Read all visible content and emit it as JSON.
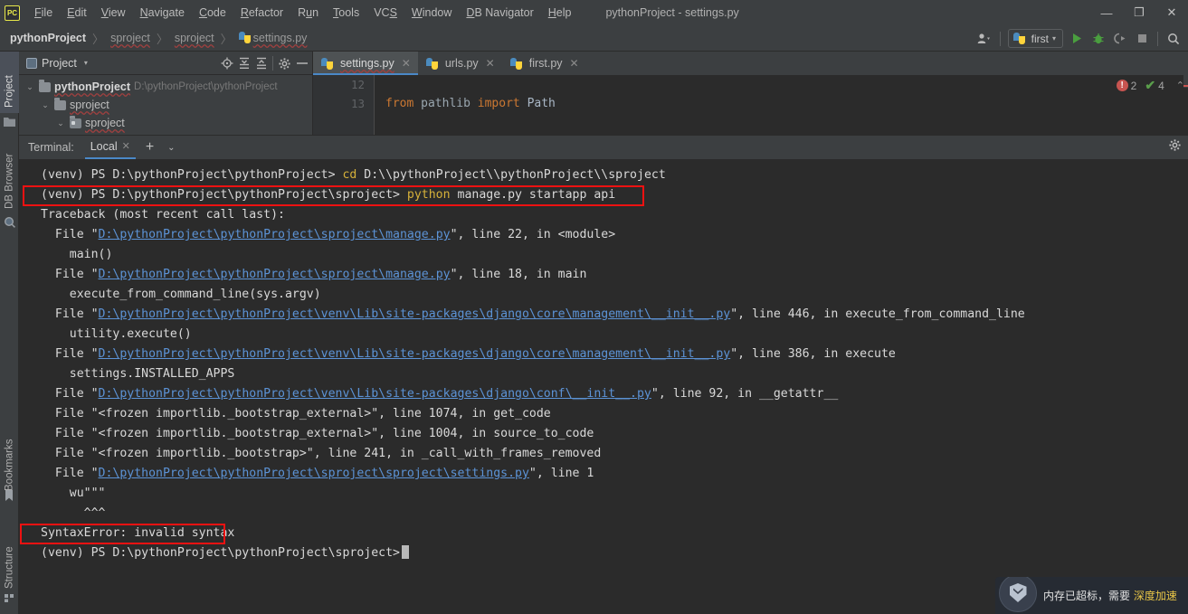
{
  "titlebar": {
    "logo": "PC",
    "window_title": "pythonProject - settings.py",
    "menus": [
      {
        "label": "File",
        "mnemonic": "F"
      },
      {
        "label": "Edit",
        "mnemonic": "E"
      },
      {
        "label": "View",
        "mnemonic": "V"
      },
      {
        "label": "Navigate",
        "mnemonic": "N"
      },
      {
        "label": "Code",
        "mnemonic": "C"
      },
      {
        "label": "Refactor",
        "mnemonic": "R"
      },
      {
        "label": "Run",
        "mnemonic": "u"
      },
      {
        "label": "Tools",
        "mnemonic": "T"
      },
      {
        "label": "VCS",
        "mnemonic": "S"
      },
      {
        "label": "Window",
        "mnemonic": "W"
      },
      {
        "label": "DB Navigator",
        "mnemonic": "D"
      },
      {
        "label": "Help",
        "mnemonic": "H"
      }
    ],
    "controls": {
      "minimize": "—",
      "maximize": "❐",
      "close": "✕"
    }
  },
  "breadcrumb": {
    "items": [
      "pythonProject",
      "sproject",
      "sproject",
      "settings.py"
    ],
    "separator": "〉",
    "file_icon": "python-file-icon"
  },
  "toolbar": {
    "user_icon": "user-icon",
    "run_config": {
      "name": "first",
      "icon": "python-icon",
      "caret": "▾"
    },
    "run_icon": "▶",
    "debug_icon": "debug-bug-icon",
    "coverage_icon": "coverage-run-icon",
    "stop_icon": "■",
    "search_icon": "search-icon"
  },
  "left_strip": [
    {
      "label": "Project",
      "active": true,
      "icon": "folder-icon"
    },
    {
      "label": "DB Browser",
      "active": false,
      "icon": "db-icon"
    },
    {
      "label": "Bookmarks",
      "active": false,
      "icon": "bookmark-icon"
    },
    {
      "label": "Structure",
      "active": false,
      "icon": "structure-icon"
    }
  ],
  "project_panel": {
    "title": "Project",
    "dropdown_caret": "▾",
    "tools": [
      "locate-icon",
      "expand-all-icon",
      "collapse-all-icon",
      "settings-gear-icon",
      "hide-panel-icon"
    ],
    "tree": [
      {
        "label": "pythonProject",
        "path": "D:\\pythonProject\\pythonProject",
        "depth": 0,
        "expanded": true,
        "bold": true,
        "kind": "folder"
      },
      {
        "label": "sproject",
        "path": "",
        "depth": 1,
        "expanded": true,
        "bold": false,
        "kind": "folder"
      },
      {
        "label": "sproject",
        "path": "",
        "depth": 2,
        "expanded": true,
        "bold": false,
        "kind": "module"
      }
    ]
  },
  "editor": {
    "tabs": [
      {
        "label": "settings.py",
        "active": true
      },
      {
        "label": "urls.py",
        "active": false
      },
      {
        "label": "first.py",
        "active": false
      }
    ],
    "close_glyph": "✕",
    "lines": [
      {
        "num": "12",
        "tokens": []
      },
      {
        "num": "13",
        "tokens": [
          {
            "text": "from ",
            "cls": "kw"
          },
          {
            "text": "pathlib ",
            "cls": "mod-name"
          },
          {
            "text": "import ",
            "cls": "kw"
          },
          {
            "text": "Path",
            "cls": "ident"
          }
        ]
      }
    ],
    "status": {
      "error_glyph": "!",
      "error_count": "2",
      "check_glyph": "✔",
      "check_count": "4",
      "chevron": "⌃"
    }
  },
  "terminal": {
    "label": "Terminal:",
    "tab": "Local",
    "close_glyph": "✕",
    "plus": "+",
    "chevron": "⌄",
    "gear": "settings-gear-icon",
    "lines": [
      {
        "id": "l1",
        "segments": [
          {
            "text": "(venv) PS D:\\pythonProject\\pythonProject> ",
            "cls": "c-white"
          },
          {
            "text": "cd ",
            "cls": "c-yellow"
          },
          {
            "text": "D:\\\\pythonProject\\\\pythonProject\\\\sproject",
            "cls": "c-white"
          }
        ]
      },
      {
        "id": "l2",
        "highlighted": true,
        "segments": [
          {
            "text": "(venv) PS D:\\pythonProject\\pythonProject\\sproject> ",
            "cls": "c-white"
          },
          {
            "text": "python ",
            "cls": "c-yellow"
          },
          {
            "text": "manage.py startapp api",
            "cls": "c-white"
          }
        ]
      },
      {
        "id": "l3",
        "segments": [
          {
            "text": "Traceback (most recent call last):",
            "cls": "c-white"
          }
        ]
      },
      {
        "id": "l4",
        "segments": [
          {
            "text": "  File \"",
            "cls": "c-white"
          },
          {
            "text": "D:\\pythonProject\\pythonProject\\sproject\\manage.py",
            "cls": "c-link"
          },
          {
            "text": "\", line 22, in <module>",
            "cls": "c-white"
          }
        ]
      },
      {
        "id": "l5",
        "segments": [
          {
            "text": "    main()",
            "cls": "c-white"
          }
        ]
      },
      {
        "id": "l6",
        "segments": [
          {
            "text": "  File \"",
            "cls": "c-white"
          },
          {
            "text": "D:\\pythonProject\\pythonProject\\sproject\\manage.py",
            "cls": "c-link"
          },
          {
            "text": "\", line 18, in main",
            "cls": "c-white"
          }
        ]
      },
      {
        "id": "l7",
        "segments": [
          {
            "text": "    execute_from_command_line(sys.argv)",
            "cls": "c-white"
          }
        ]
      },
      {
        "id": "l8",
        "segments": [
          {
            "text": "  File \"",
            "cls": "c-white"
          },
          {
            "text": "D:\\pythonProject\\pythonProject\\venv\\Lib\\site-packages\\django\\core\\management\\__init__.py",
            "cls": "c-link"
          },
          {
            "text": "\", line 446, in execute_from_command_line",
            "cls": "c-white"
          }
        ]
      },
      {
        "id": "l9",
        "segments": [
          {
            "text": "    utility.execute()",
            "cls": "c-white"
          }
        ]
      },
      {
        "id": "l10",
        "segments": [
          {
            "text": "  File \"",
            "cls": "c-white"
          },
          {
            "text": "D:\\pythonProject\\pythonProject\\venv\\Lib\\site-packages\\django\\core\\management\\__init__.py",
            "cls": "c-link"
          },
          {
            "text": "\", line 386, in execute",
            "cls": "c-white"
          }
        ]
      },
      {
        "id": "l11",
        "segments": [
          {
            "text": "    settings.INSTALLED_APPS",
            "cls": "c-white"
          }
        ]
      },
      {
        "id": "l12",
        "segments": [
          {
            "text": "  File \"",
            "cls": "c-white"
          },
          {
            "text": "D:\\pythonProject\\pythonProject\\venv\\Lib\\site-packages\\django\\conf\\__init__.py",
            "cls": "c-link"
          },
          {
            "text": "\", line 92, in __getattr__",
            "cls": "c-white"
          }
        ]
      },
      {
        "id": "l13",
        "segments": [
          {
            "text": "  File \"<frozen importlib._bootstrap_external>\", line 1074, in get_code",
            "cls": "c-white"
          }
        ]
      },
      {
        "id": "l14",
        "segments": [
          {
            "text": "  File \"<frozen importlib._bootstrap_external>\", line 1004, in source_to_code",
            "cls": "c-white"
          }
        ]
      },
      {
        "id": "l15",
        "segments": [
          {
            "text": "  File \"<frozen importlib._bootstrap>\", line 241, in _call_with_frames_removed",
            "cls": "c-white"
          }
        ]
      },
      {
        "id": "l16",
        "segments": [
          {
            "text": "  File \"",
            "cls": "c-white"
          },
          {
            "text": "D:\\pythonProject\\pythonProject\\sproject\\sproject\\settings.py",
            "cls": "c-link"
          },
          {
            "text": "\", line 1",
            "cls": "c-white"
          }
        ]
      },
      {
        "id": "l17",
        "segments": [
          {
            "text": "    wu\"\"\"",
            "cls": "c-white"
          }
        ]
      },
      {
        "id": "l18",
        "segments": [
          {
            "text": "      ^^^",
            "cls": "c-white"
          }
        ]
      },
      {
        "id": "l19",
        "highlighted": true,
        "segments": [
          {
            "text": "SyntaxError: invalid syntax",
            "cls": "c-white"
          }
        ]
      },
      {
        "id": "l20",
        "prompt": true,
        "segments": [
          {
            "text": "(venv) PS D:\\pythonProject\\pythonProject\\sproject>",
            "cls": "c-white"
          }
        ]
      }
    ]
  },
  "notification": {
    "icon": "shield-icon",
    "text": "内存已超标，需要 ",
    "link": "深度加速"
  },
  "colors": {
    "chrome": "#3c3f41",
    "editor_bg": "#2b2b2b",
    "accent_blue": "#4a88c7",
    "link_blue": "#5c93d6",
    "keyword_orange": "#cc7832",
    "terminal_yellow": "#d6b13a",
    "highlight_red": "#ee1111",
    "error_red": "#c75450",
    "ok_green": "#5a9e4b"
  }
}
